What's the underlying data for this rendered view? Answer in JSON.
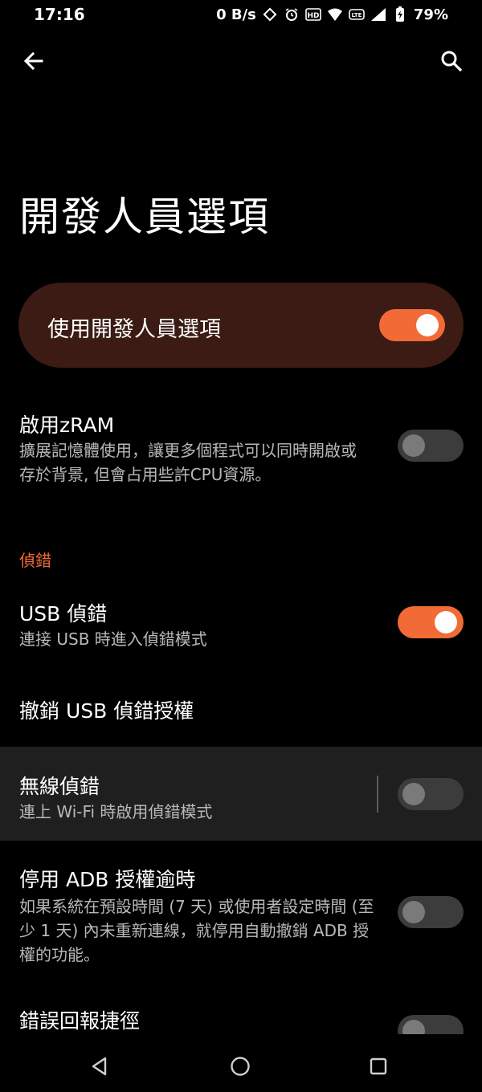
{
  "status": {
    "time": "17:16",
    "net_speed": "0 B/s",
    "battery": "79%",
    "icons": [
      "rotate-icon",
      "alarm-icon",
      "hd-icon",
      "wifi-icon",
      "volte-icon",
      "signal-icon",
      "battery-charging-icon"
    ]
  },
  "topbar": {
    "back_icon": "arrow-left-icon",
    "search_icon": "search-icon"
  },
  "page": {
    "title": "開發人員選項"
  },
  "master": {
    "label": "使用開發人員選項",
    "enabled": true
  },
  "zram": {
    "title": "啟用zRAM",
    "subtitle_line1": "擴展記憶體使用，讓更多個程式可以同時開啟或",
    "subtitle_line2": "存於背景, 但會占用些許CPU資源。",
    "enabled": false
  },
  "section": {
    "debug_header": "偵錯"
  },
  "usb_debug": {
    "title": "USB 偵錯",
    "subtitle": "連接 USB 時進入偵錯模式",
    "enabled": true
  },
  "revoke_usb": {
    "title": "撤銷 USB 偵錯授權"
  },
  "wireless_debug": {
    "title": "無線偵錯",
    "subtitle": "連上 Wi-Fi 時啟用偵錯模式",
    "enabled": false
  },
  "adb_timeout": {
    "title": "停用 ADB 授權逾時",
    "subtitle_line1": "如果系統在預設時間 (7 天) 或使用者設定時間 (至",
    "subtitle_line2": "少 1 天) 內未重新連線，就停用自動撤銷 ADB 授",
    "subtitle_line3": "權的功能。",
    "enabled": false
  },
  "bug_report": {
    "title": "錯誤回報捷徑",
    "enabled": false
  },
  "navbar": {
    "back_icon": "nav-back-icon",
    "home_icon": "nav-home-icon",
    "recents_icon": "nav-recents-icon"
  },
  "colors": {
    "accent": "#f26a36",
    "card": "#3b1b13",
    "background": "#000000"
  }
}
